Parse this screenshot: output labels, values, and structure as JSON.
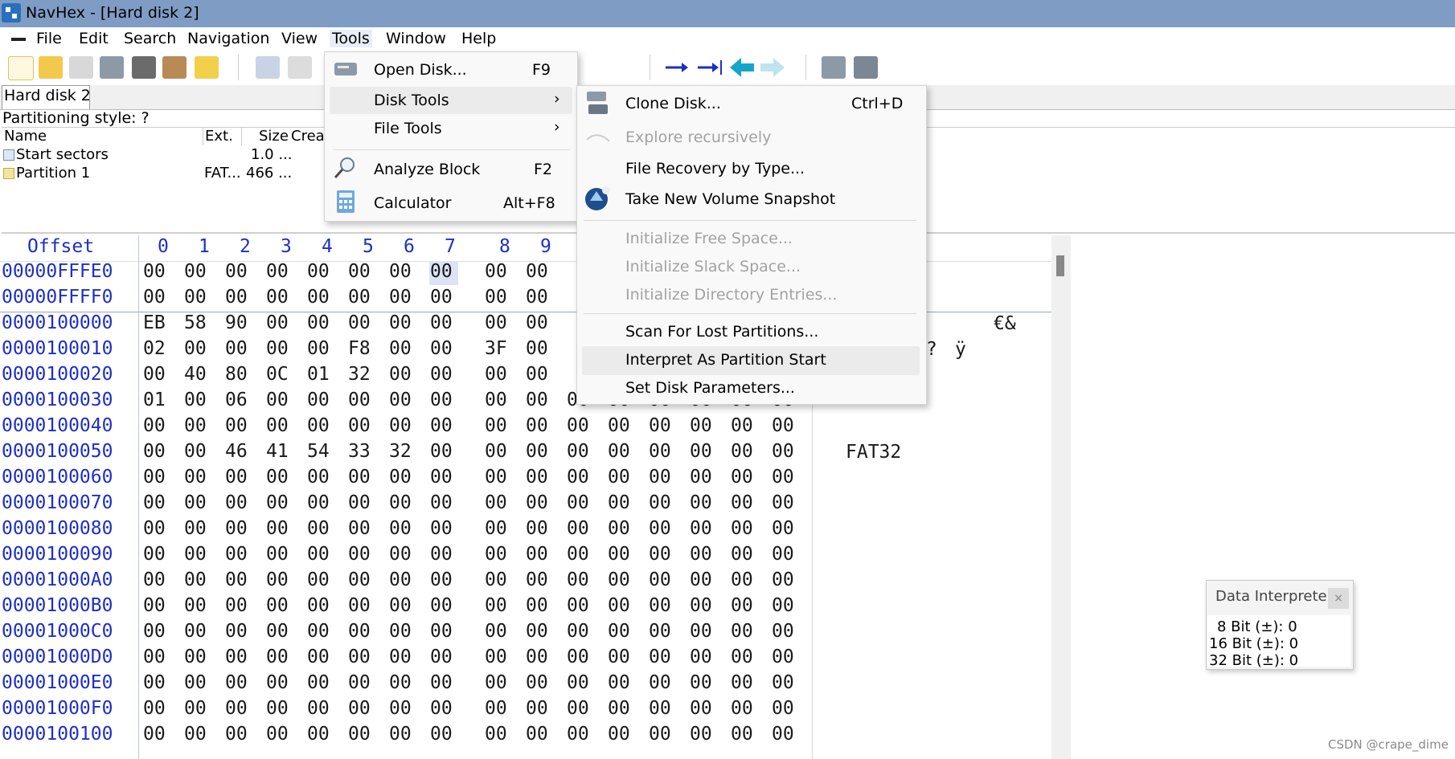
{
  "window": {
    "title": "NavHex - [Hard disk 2]"
  },
  "menubar": {
    "items": [
      "File",
      "Edit",
      "Search",
      "Navigation",
      "View",
      "Tools",
      "Window",
      "Help"
    ]
  },
  "toolbar": {
    "icons": [
      "new-file-icon",
      "open-folder-icon",
      "save-icon",
      "open-disk-icon",
      "print-icon",
      "copy-icon",
      "folder-icon",
      "undo-icon",
      "paste-icon",
      "arrow-right-icon",
      "arrow-right-end-icon",
      "arrow-left-icon",
      "arrow-forward-icon",
      "disk-icon",
      "disk-stack-icon"
    ]
  },
  "tabs": [
    {
      "label": "Hard disk 2"
    }
  ],
  "partition_panel": {
    "style_label": "Partitioning style: ?",
    "columns": [
      "Name",
      "Ext.",
      "Size",
      "Crea"
    ],
    "rows": [
      {
        "name": "Start sectors",
        "ext": "",
        "size": "1.0 ..."
      },
      {
        "name": "Partition 1",
        "ext": "FAT...",
        "size": "466 ..."
      }
    ]
  },
  "hex": {
    "offset_header": "Offset",
    "columns": [
      "0",
      "1",
      "2",
      "3",
      "4",
      "5",
      "6",
      "7",
      "8",
      "9"
    ],
    "visible_extra_columns": [
      "00",
      "00",
      "00",
      "00",
      "00",
      "00"
    ],
    "rows": [
      {
        "offset": "00000FFFE0",
        "bytes": [
          "00",
          "00",
          "00",
          "00",
          "00",
          "00",
          "00",
          "00",
          "00",
          "00"
        ]
      },
      {
        "offset": "00000FFFF0",
        "bytes": [
          "00",
          "00",
          "00",
          "00",
          "00",
          "00",
          "00",
          "00",
          "00",
          "00"
        ]
      },
      {
        "offset": "0000100000",
        "bytes": [
          "EB",
          "58",
          "90",
          "00",
          "00",
          "00",
          "00",
          "00",
          "00",
          "00"
        ]
      },
      {
        "offset": "0000100010",
        "bytes": [
          "02",
          "00",
          "00",
          "00",
          "00",
          "F8",
          "00",
          "00",
          "3F",
          "00"
        ]
      },
      {
        "offset": "0000100020",
        "bytes": [
          "00",
          "40",
          "80",
          "0C",
          "01",
          "32",
          "00",
          "00",
          "00",
          "00"
        ]
      },
      {
        "offset": "0000100030",
        "bytes": [
          "01",
          "00",
          "06",
          "00",
          "00",
          "00",
          "00",
          "00",
          "00",
          "00"
        ]
      },
      {
        "offset": "0000100040",
        "bytes": [
          "00",
          "00",
          "00",
          "00",
          "00",
          "00",
          "00",
          "00",
          "00",
          "00"
        ]
      },
      {
        "offset": "0000100050",
        "bytes": [
          "00",
          "00",
          "46",
          "41",
          "54",
          "33",
          "32",
          "00",
          "00",
          "00"
        ]
      },
      {
        "offset": "0000100060",
        "bytes": [
          "00",
          "00",
          "00",
          "00",
          "00",
          "00",
          "00",
          "00",
          "00",
          "00"
        ]
      },
      {
        "offset": "0000100070",
        "bytes": [
          "00",
          "00",
          "00",
          "00",
          "00",
          "00",
          "00",
          "00",
          "00",
          "00"
        ]
      },
      {
        "offset": "0000100080",
        "bytes": [
          "00",
          "00",
          "00",
          "00",
          "00",
          "00",
          "00",
          "00",
          "00",
          "00"
        ]
      },
      {
        "offset": "0000100090",
        "bytes": [
          "00",
          "00",
          "00",
          "00",
          "00",
          "00",
          "00",
          "00",
          "00",
          "00"
        ]
      },
      {
        "offset": "00001000A0",
        "bytes": [
          "00",
          "00",
          "00",
          "00",
          "00",
          "00",
          "00",
          "00",
          "00",
          "00"
        ]
      },
      {
        "offset": "00001000B0",
        "bytes": [
          "00",
          "00",
          "00",
          "00",
          "00",
          "00",
          "00",
          "00",
          "00",
          "00"
        ]
      },
      {
        "offset": "00001000C0",
        "bytes": [
          "00",
          "00",
          "00",
          "00",
          "00",
          "00",
          "00",
          "00",
          "00",
          "00"
        ]
      },
      {
        "offset": "00001000D0",
        "bytes": [
          "00",
          "00",
          "00",
          "00",
          "00",
          "00",
          "00",
          "00",
          "00",
          "00"
        ]
      },
      {
        "offset": "00001000E0",
        "bytes": [
          "00",
          "00",
          "00",
          "00",
          "00",
          "00",
          "00",
          "00",
          "00",
          "00"
        ]
      },
      {
        "offset": "00001000F0",
        "bytes": [
          "00",
          "00",
          "00",
          "00",
          "00",
          "00",
          "00",
          "00",
          "00",
          "00"
        ]
      },
      {
        "offset": "0000100100",
        "bytes": [
          "00",
          "00",
          "00",
          "00",
          "00",
          "00",
          "00",
          "00",
          "00",
          "00"
        ]
      }
    ],
    "ascii": {
      "r0": "€&",
      "r1a": "?",
      "r1b": "ÿ",
      "r5": "FAT32"
    }
  },
  "tools_menu": {
    "items": [
      {
        "label": "Open Disk...",
        "shortcut": "F9",
        "icon": "open-disk-icon"
      },
      {
        "label": "Disk Tools",
        "submenu": true
      },
      {
        "label": "File Tools",
        "submenu": true
      },
      {
        "label": "Analyze Block",
        "shortcut": "F2",
        "icon": "magnifier-icon"
      },
      {
        "label": "Calculator",
        "shortcut": "Alt+F8",
        "icon": "calculator-icon"
      }
    ]
  },
  "disk_tools_menu": {
    "items": [
      {
        "label": "Clone Disk...",
        "shortcut": "Ctrl+D",
        "enabled": true
      },
      {
        "label": "Explore recursively",
        "enabled": false
      },
      {
        "label": "File Recovery by Type...",
        "enabled": true
      },
      {
        "label": "Take New Volume Snapshot",
        "enabled": true
      },
      {
        "label": "Initialize Free Space...",
        "enabled": false
      },
      {
        "label": "Initialize Slack Space...",
        "enabled": false
      },
      {
        "label": "Initialize Directory Entries...",
        "enabled": false
      },
      {
        "label": "Scan For Lost Partitions...",
        "enabled": true
      },
      {
        "label": "Interpret As Partition Start",
        "enabled": true
      },
      {
        "label": "Set Disk Parameters...",
        "enabled": true
      }
    ]
  },
  "data_interpreter": {
    "title": "Data Interpreter",
    "close": "×",
    "lines": [
      "8 Bit (±): 0",
      "16 Bit (±): 0",
      "32 Bit (±): 0"
    ]
  },
  "watermark": "CSDN @crape_dime",
  "colors": {
    "titlebar": "#7f9cc4",
    "offset_blue": "#1d2fc8",
    "highlight": "#dde3f5"
  }
}
